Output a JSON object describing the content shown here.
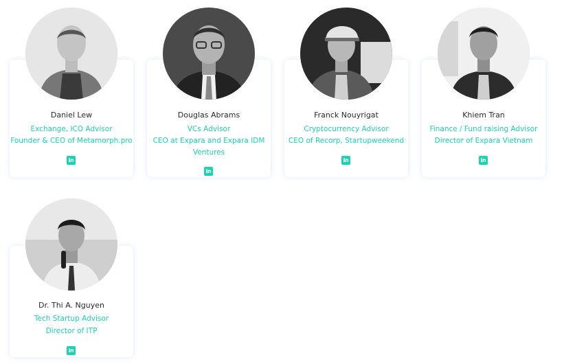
{
  "team": [
    {
      "name": "Daniel Lew",
      "role": "Exchange, ICO Advisor",
      "company": "Founder & CEO of Metamorph.pro",
      "social_icon": "linkedin-icon"
    },
    {
      "name": "Douglas Abrams",
      "role": "VCs Advisor",
      "company": "CEO at Expara and Expara IDM Ventures",
      "social_icon": "linkedin-icon"
    },
    {
      "name": "Franck Nouyrigat",
      "role": "Cryptocurrency Advisor",
      "company": "CEO of Recorp, Startupweekend",
      "social_icon": "linkedin-icon"
    },
    {
      "name": "Khiem Tran",
      "role": "Finance / Fund raising Advisor",
      "company": "Director of Expara Vietnam",
      "social_icon": "linkedin-icon"
    },
    {
      "name": "Dr. Thi A. Nguyen",
      "role": "Tech Startup Advisor",
      "company": "Director of ITP",
      "social_icon": "linkedin-icon"
    }
  ],
  "colors": {
    "accent": "#1fd1b1",
    "name_text": "#2b2b2b",
    "card_shadow": "#e3e9fb"
  }
}
